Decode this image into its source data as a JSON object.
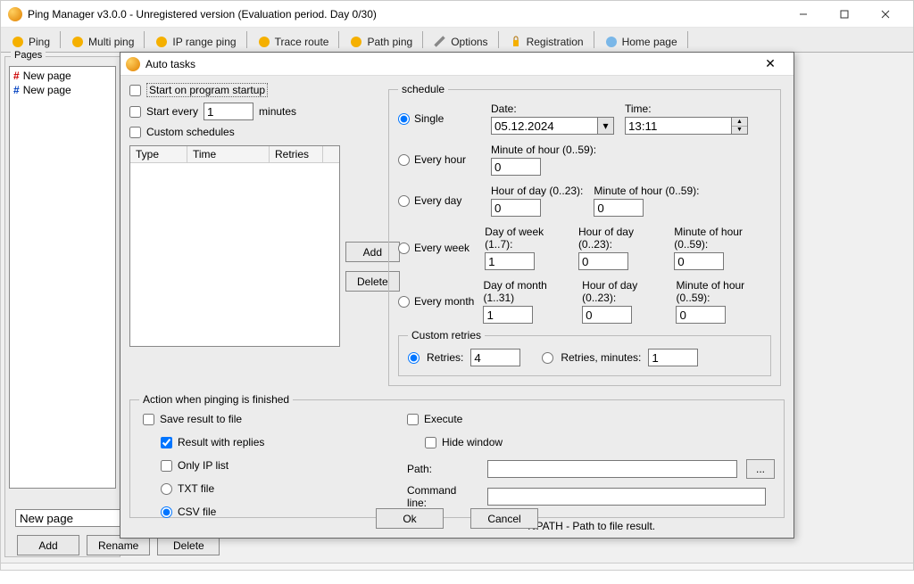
{
  "window": {
    "title": "Ping Manager v3.0.0 - Unregistered version (Evaluation period. Day 0/30)"
  },
  "toolbar": {
    "ping": "Ping",
    "multi_ping": "Multi ping",
    "ip_range_ping": "IP range ping",
    "trace_route": "Trace route",
    "path_ping": "Path ping",
    "options": "Options",
    "registration": "Registration",
    "home_page": "Home page"
  },
  "pages": {
    "label": "Pages",
    "items": [
      "New page",
      "New page"
    ],
    "address_value": "New page",
    "add": "Add",
    "rename": "Rename",
    "delete": "Delete"
  },
  "dialog": {
    "title": "Auto tasks",
    "start_on_startup": "Start on program startup",
    "start_every": "Start every",
    "start_every_value": "1",
    "minutes": "minutes",
    "custom_schedules": "Custom schedules",
    "table": {
      "col1": "Type",
      "col2": "Time",
      "col3": "Retries"
    },
    "add": "Add",
    "delete": "Delete",
    "schedule": {
      "legend": "schedule",
      "single": "Single",
      "date_label": "Date:",
      "date_value": "05.12.2024",
      "time_label": "Time:",
      "time_value": "13:11",
      "every_hour": "Every hour",
      "minute_of_hour": "Minute of hour (0..59):",
      "minute_of_hour_val": "0",
      "every_day": "Every day",
      "hour_of_day": "Hour of day (0..23):",
      "hour_of_day_val": "0",
      "minute_of_hour2_val": "0",
      "every_week": "Every week",
      "day_of_week": "Day of week (1..7):",
      "day_of_week_val": "1",
      "week_hour_val": "0",
      "week_min_val": "0",
      "every_month": "Every month",
      "day_of_month": "Day of month (1..31)",
      "day_of_month_val": "1",
      "month_hour_val": "0",
      "month_min_val": "0"
    },
    "retries": {
      "legend": "Custom retries",
      "retries_label": "Retries:",
      "retries_value": "4",
      "retries_minutes_label": "Retries, minutes:",
      "retries_minutes_value": "1"
    },
    "action": {
      "legend": "Action when pinging is finished",
      "save_result": "Save result to file",
      "result_replies": "Result with replies",
      "only_ip": "Only IP list",
      "txt_file": "TXT file",
      "csv_file": "CSV file",
      "execute": "Execute",
      "hide_window": "Hide window",
      "path": "Path:",
      "path_val": "",
      "browse": "...",
      "command_line": "Command line:",
      "command_val": "",
      "hint": "%PATH - Path to file result."
    },
    "ok": "Ok",
    "cancel": "Cancel"
  }
}
